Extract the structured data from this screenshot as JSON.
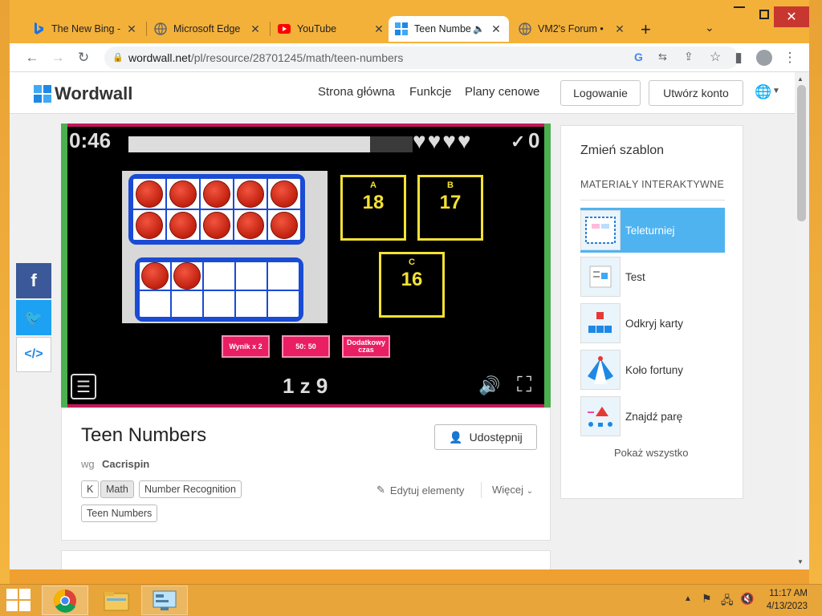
{
  "browser": {
    "tabs": [
      {
        "title": "The New Bing -",
        "icon": "bing-icon"
      },
      {
        "title": "Microsoft Edge",
        "icon": "globe-icon"
      },
      {
        "title": "YouTube",
        "icon": "youtube-icon"
      },
      {
        "title": "Teen Numbe",
        "icon": "wordwall-icon",
        "active": true
      },
      {
        "title": "VM2's Forum •",
        "icon": "globe-icon"
      }
    ],
    "url_host": "wordwall.net",
    "url_path": "/pl/resource/28701245/math/teen-numbers"
  },
  "site": {
    "logo": "Wordwall",
    "nav": [
      "Strona główna",
      "Funkcje",
      "Plany cenowe"
    ],
    "login": "Logowanie",
    "signup": "Utwórz konto"
  },
  "game": {
    "timer": "0:46",
    "progress_fraction": 0.85,
    "lives": 4,
    "score_mark": "✓",
    "score": "0",
    "frame_counters": [
      10,
      2
    ],
    "answers": [
      {
        "letter": "A",
        "value": "18"
      },
      {
        "letter": "B",
        "value": "17"
      },
      {
        "letter": "C",
        "value": "16"
      }
    ],
    "powerups": [
      "Wynik x 2",
      "50: 50",
      "Dodatkowy czas"
    ],
    "question_counter": "1 z 9"
  },
  "activity": {
    "title": "Teen Numbers",
    "by_label": "wg",
    "author": "Cacrispin",
    "share": "Udostępnij",
    "tags": [
      "K",
      "Math",
      "Number Recognition",
      "Teen Numbers"
    ],
    "edit": "Edytuj elementy",
    "more": "Więcej"
  },
  "templates": {
    "heading": "Zmień szablon",
    "section": "MATERIAŁY INTERAKTYWNE",
    "items": [
      "Teleturniej",
      "Test",
      "Odkryj karty",
      "Koło fortuny",
      "Znajdź parę"
    ],
    "selected": "Teleturniej",
    "show_all": "Pokaż wszystko"
  },
  "taskbar": {
    "time": "11:17 AM",
    "date": "4/13/2023"
  },
  "colors": {
    "accent_selected": "#4fb3f0",
    "game_border": "#c2185b",
    "answer_yellow": "#f4e233"
  }
}
